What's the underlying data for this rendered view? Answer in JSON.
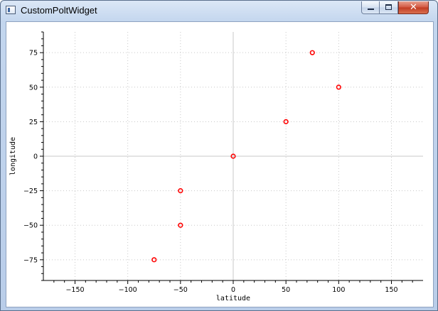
{
  "window": {
    "title": "CustomPoltWidget",
    "icon": "app-window-icon",
    "controls": {
      "minimize_icon": "minimize-icon",
      "maximize_icon": "maximize-icon",
      "close_icon": "close-icon",
      "close_glyph": "✕"
    }
  },
  "chart_data": {
    "type": "scatter",
    "xlabel": "latitude",
    "ylabel": "longitude",
    "xlim": [
      -180,
      180
    ],
    "ylim": [
      -90,
      90
    ],
    "xticks": [
      -150,
      -100,
      -50,
      0,
      50,
      100,
      150
    ],
    "yticks": [
      -75,
      -50,
      -25,
      0,
      25,
      50,
      75
    ],
    "xtick_labels": [
      "−150",
      "−100",
      "−50",
      "0",
      "50",
      "100",
      "150"
    ],
    "ytick_labels": [
      "−75",
      "−50",
      "−25",
      "0",
      "25",
      "50",
      "75"
    ],
    "grid": true,
    "marker_color": "#ff0000",
    "points": [
      {
        "x": -75,
        "y": -75
      },
      {
        "x": -50,
        "y": -50
      },
      {
        "x": -50,
        "y": -25
      },
      {
        "x": 0,
        "y": 0
      },
      {
        "x": 50,
        "y": 25
      },
      {
        "x": 75,
        "y": 75
      },
      {
        "x": 100,
        "y": 50
      }
    ]
  }
}
